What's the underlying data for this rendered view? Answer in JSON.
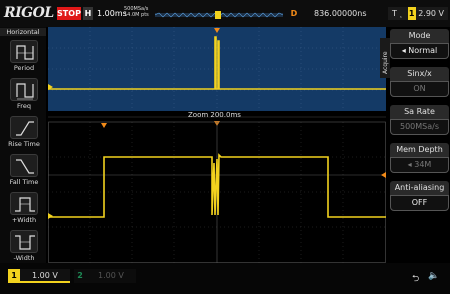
{
  "header": {
    "logo": "RIGOL",
    "run_state": "STOP",
    "timebase_letter": "H",
    "timebase_value": "1.00ms",
    "sample_rate": "500MSa/s",
    "memory_depth": "14.0M pts",
    "delay_letter": "D",
    "delay_value": "836.00000ns",
    "trigger_letter": "T",
    "trigger_channel": "1",
    "trigger_level": "2.90 V"
  },
  "left_menu": {
    "title": "Horizontal",
    "items": [
      {
        "label": "Period",
        "icon": "period-icon"
      },
      {
        "label": "Freq",
        "icon": "frequency-icon"
      },
      {
        "label": "Rise Time",
        "icon": "rise-time-icon"
      },
      {
        "label": "Fall Time",
        "icon": "fall-time-icon"
      },
      {
        "label": "+Width",
        "icon": "positive-width-icon"
      },
      {
        "label": "-Width",
        "icon": "negative-width-icon"
      }
    ]
  },
  "screen": {
    "zoom_label": "Zoom 200.0ms",
    "trace_color": "#f2d21e",
    "upper_bg": "#143a66"
  },
  "right_menu": {
    "tab_label": "Acquire",
    "mode_label": "Mode",
    "mode_value": "Normal",
    "sinx_label": "Sinx/x",
    "sinx_value": "ON",
    "sa_rate_label": "Sa Rate",
    "sa_rate_value": "500MSa/s",
    "mem_depth_label": "Mem Depth",
    "mem_depth_value": "34M",
    "anti_alias_label": "Anti-aliasing",
    "anti_alias_value": "OFF"
  },
  "footer": {
    "ch1_number": "1",
    "ch1_scale": "1.00 V",
    "ch2_number": "2",
    "ch2_scale": "1.00 V",
    "colors": {
      "ch1": "#f2d21e",
      "ch2": "#1d8a55",
      "stop": "#e01818",
      "trigger_marker": "#f28a18"
    }
  }
}
